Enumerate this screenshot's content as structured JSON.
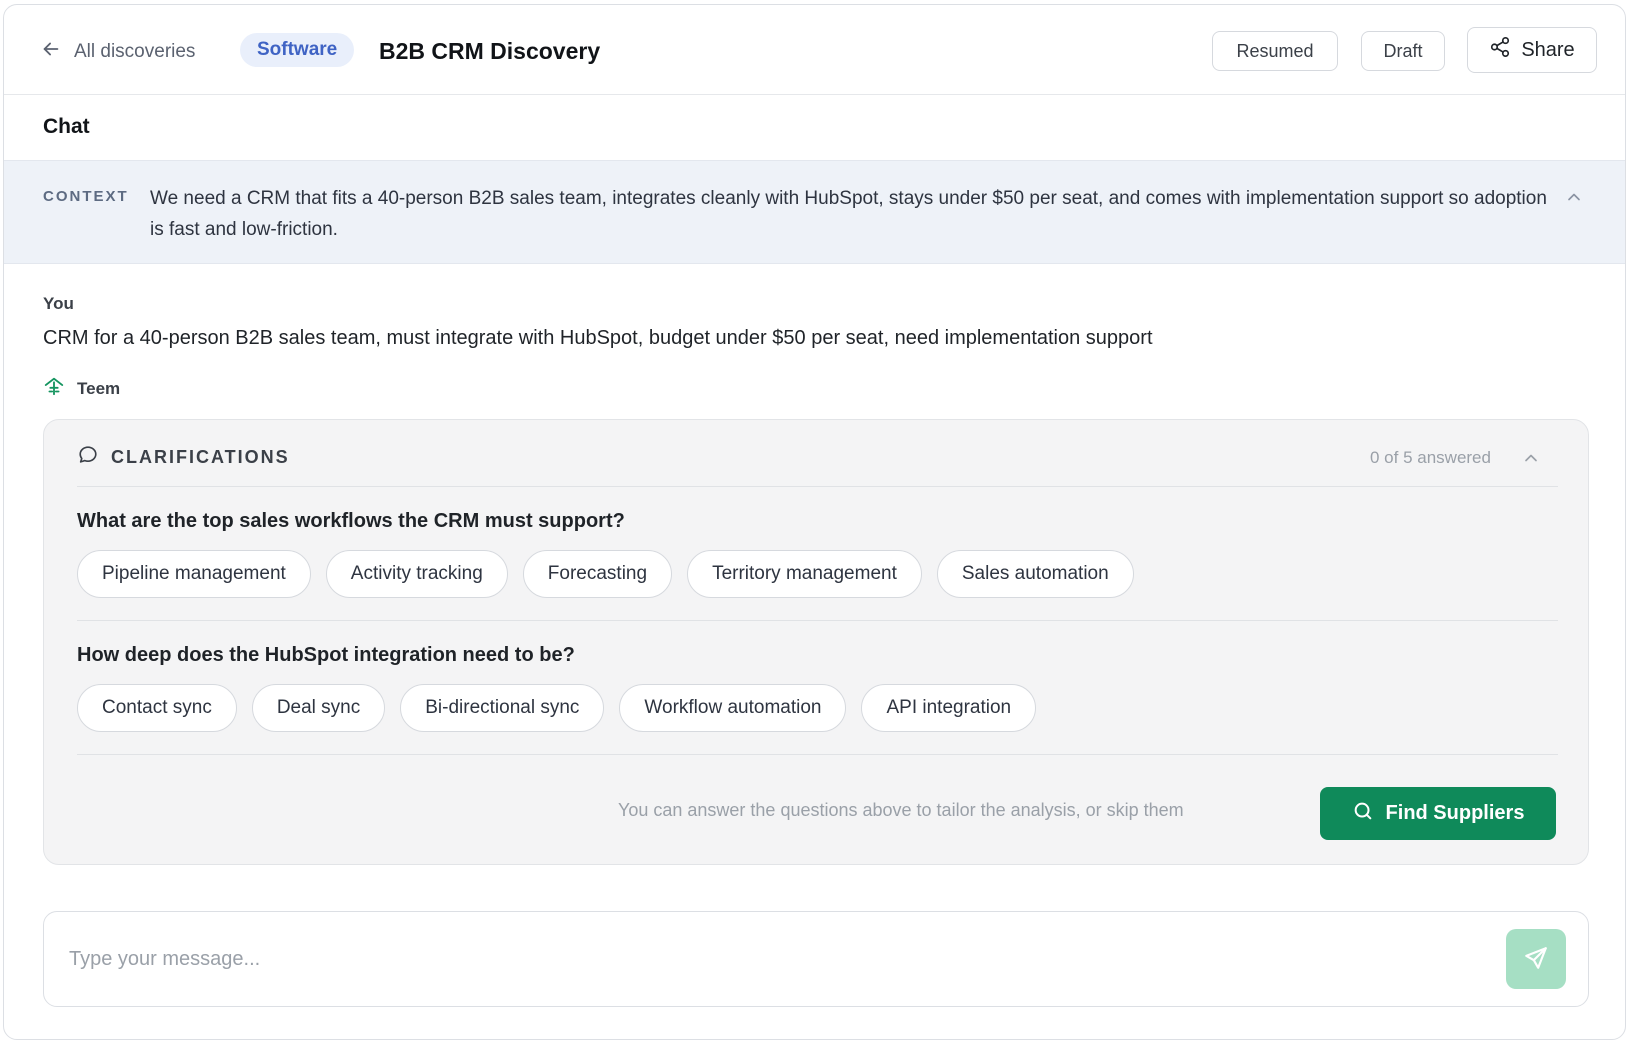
{
  "header": {
    "back_label": "All discoveries",
    "category_badge": "Software",
    "title": "B2B CRM Discovery",
    "status_resumed": "Resumed",
    "status_draft": "Draft",
    "share_label": "Share"
  },
  "chat": {
    "title": "Chat"
  },
  "context": {
    "label": "CONTEXT",
    "text": "We need a CRM that fits a 40-person B2B sales team, integrates cleanly with HubSpot, stays under $50 per seat, and comes with implementation support so adoption is fast and low-friction."
  },
  "user_message": {
    "author": "You",
    "text": "CRM for a 40-person B2B sales team, must integrate with HubSpot, budget under $50 per seat, need implementation support"
  },
  "agent": {
    "name": "Teem"
  },
  "clarifications": {
    "title": "CLARIFICATIONS",
    "answered_status": "0 of 5 answered",
    "questions": [
      {
        "text": "What are the top sales workflows the CRM must support?",
        "options": [
          "Pipeline management",
          "Activity tracking",
          "Forecasting",
          "Territory management",
          "Sales automation"
        ]
      },
      {
        "text": "How deep does the HubSpot integration need to be?",
        "options": [
          "Contact sync",
          "Deal sync",
          "Bi-directional sync",
          "Workflow automation",
          "API integration"
        ]
      }
    ],
    "hint": "You can answer the questions above to tailor the analysis, or skip them",
    "find_button": "Find Suppliers"
  },
  "composer": {
    "placeholder": "Type your message...",
    "value": ""
  },
  "colors": {
    "accent_green": "#0f8a5a",
    "send_disabled": "#a6dfc4",
    "badge_bg": "#e9effb",
    "badge_text": "#3f63c4",
    "context_bg": "#eef2f8"
  }
}
